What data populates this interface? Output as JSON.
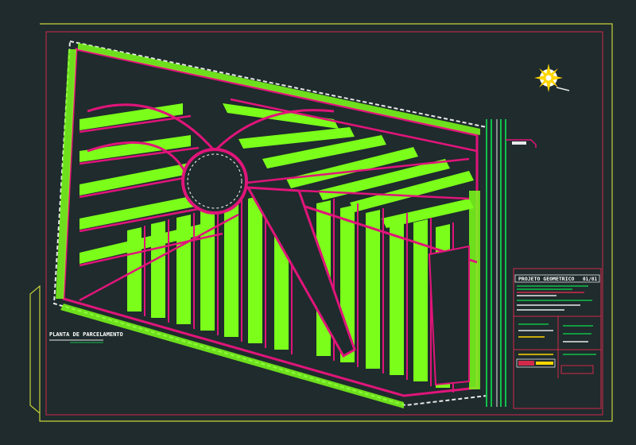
{
  "drawing": {
    "title": "PLANTA DE PARCELAMENTO",
    "background": "#1f2b2d",
    "frame_color": "#c8d23a",
    "road_color": "#e0157a",
    "lot_color": "#7bff1a",
    "green_road_color": "#12c04a"
  },
  "title_block": {
    "header": "PROJETO GEOMETRICO",
    "sheet": "01/01"
  },
  "north_arrow": {
    "icon": "north-arrow-icon"
  }
}
